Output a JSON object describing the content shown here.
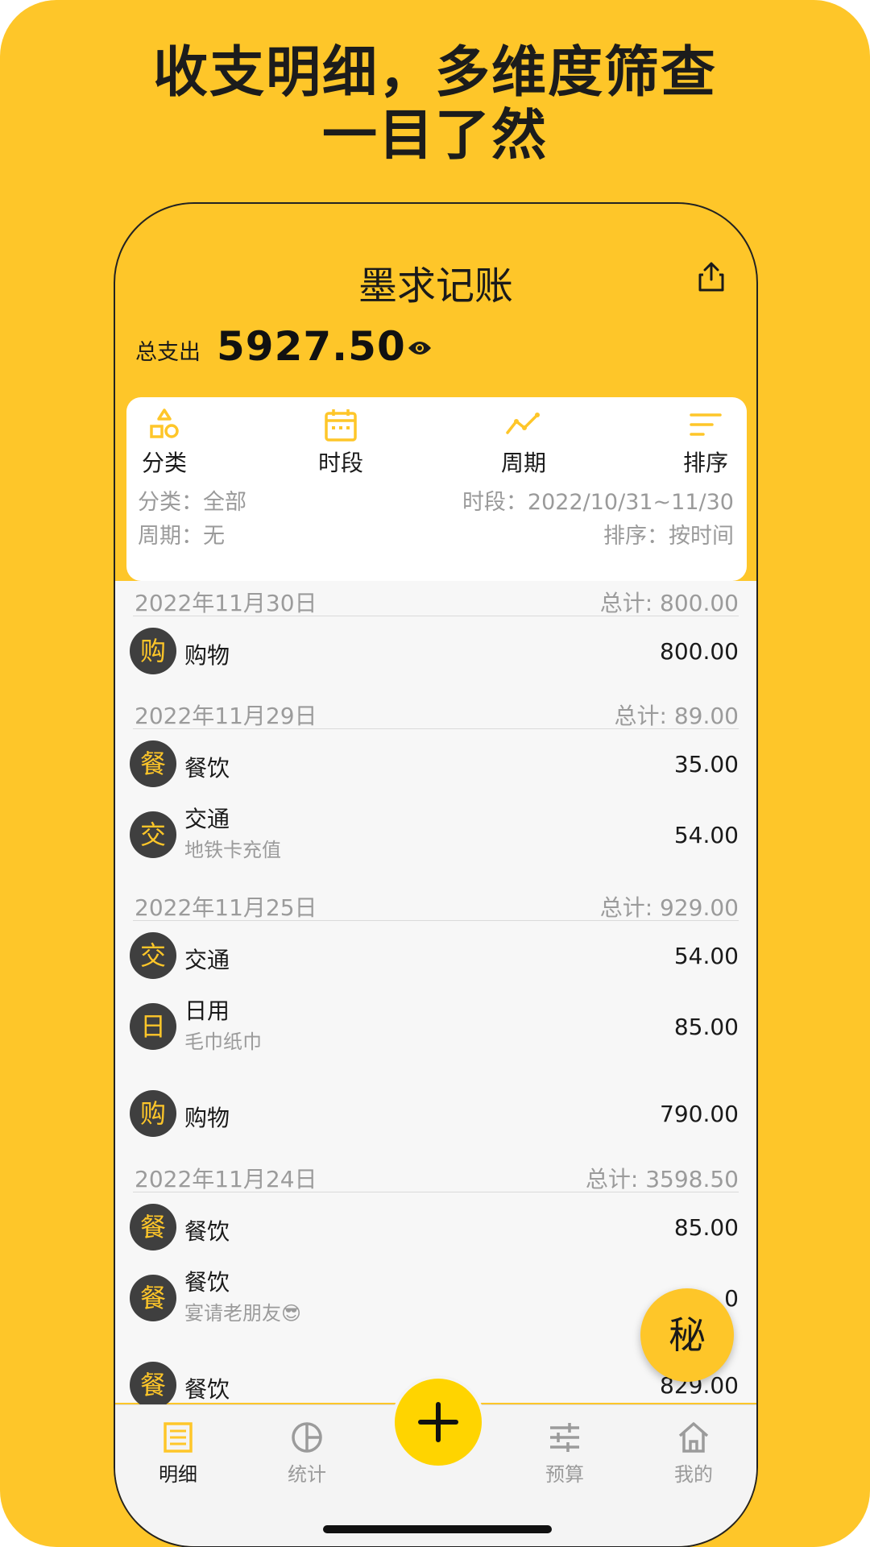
{
  "headline": {
    "line1": "收支明细，多维度筛查",
    "line2": "一目了然"
  },
  "app": {
    "title": "墨求记账",
    "share_icon": "share-icon",
    "total_label": "总支出",
    "total_value": "5927.50",
    "eye_icon": "eye-icon"
  },
  "filters": {
    "buttons": [
      {
        "label": "分类",
        "icon": "shapes-icon"
      },
      {
        "label": "时段",
        "icon": "calendar-icon"
      },
      {
        "label": "周期",
        "icon": "trend-icon"
      },
      {
        "label": "排序",
        "icon": "sort-icon"
      }
    ],
    "category": "分类：全部",
    "range": "时段：2022/10/31~11/30",
    "cycle": "周期：无",
    "sort": "排序：按时间"
  },
  "groups": [
    {
      "date": "2022年11月30日",
      "total": "总计: 800.00",
      "items": [
        {
          "badge": "购",
          "category": "购物",
          "note": "",
          "amount": "800.00"
        }
      ]
    },
    {
      "date": "2022年11月29日",
      "total": "总计: 89.00",
      "items": [
        {
          "badge": "餐",
          "category": "餐饮",
          "note": "",
          "amount": "35.00"
        },
        {
          "badge": "交",
          "category": "交通",
          "note": "地铁卡充值",
          "amount": "54.00"
        }
      ]
    },
    {
      "date": "2022年11月25日",
      "total": "总计: 929.00",
      "items": [
        {
          "badge": "交",
          "category": "交通",
          "note": "",
          "amount": "54.00"
        },
        {
          "badge": "日",
          "category": "日用",
          "note": "毛巾纸巾",
          "amount": "85.00"
        },
        {
          "badge": "购",
          "category": "购物",
          "note": "",
          "amount": "790.00"
        }
      ]
    },
    {
      "date": "2022年11月24日",
      "total": "总计: 3598.50",
      "items": [
        {
          "badge": "餐",
          "category": "餐饮",
          "note": "",
          "amount": "85.00"
        },
        {
          "badge": "餐",
          "category": "餐饮",
          "note": "宴请老朋友😎",
          "amount": "0"
        },
        {
          "badge": "餐",
          "category": "餐饮",
          "note": "",
          "amount": "829.00"
        }
      ]
    }
  ],
  "fab_secret": "秘",
  "tabs": [
    {
      "label": "明细",
      "icon": "list-icon",
      "active": true
    },
    {
      "label": "统计",
      "icon": "pie-icon",
      "active": false
    },
    {
      "label": "预算",
      "icon": "sliders-icon",
      "active": false
    },
    {
      "label": "我的",
      "icon": "home-icon",
      "active": false
    }
  ],
  "add_icon": "plus-icon",
  "colors": {
    "brand": "#FEC629",
    "badge_bg": "#3f3f3f",
    "muted": "#9b9b9b"
  }
}
